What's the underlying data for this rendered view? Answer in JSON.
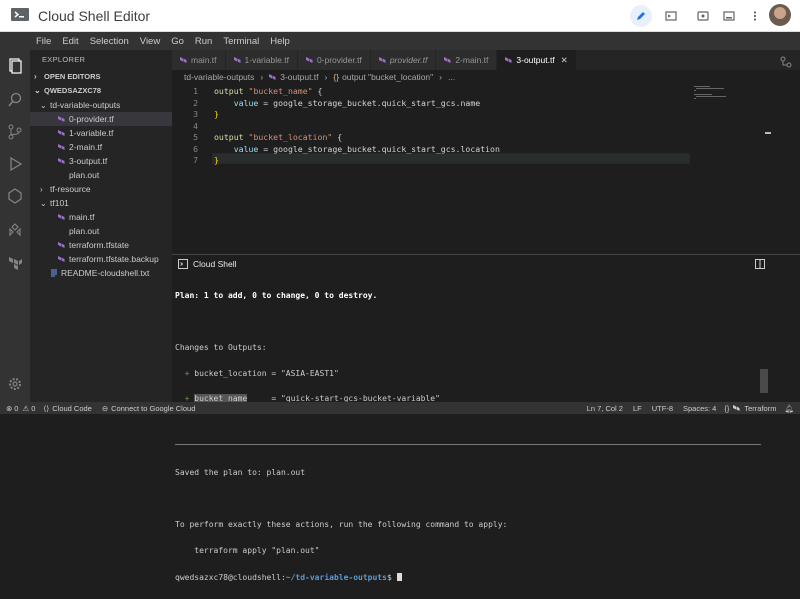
{
  "app": {
    "title": "Cloud Shell Editor"
  },
  "menu": [
    "File",
    "Edit",
    "Selection",
    "View",
    "Go",
    "Run",
    "Terminal",
    "Help"
  ],
  "sidebar": {
    "title": "EXPLORER",
    "open_editors": "OPEN EDITORS",
    "workspace": "QWEDSAZXC78",
    "folder1": "td-variable-outputs",
    "folder1_files": [
      "0-provider.tf",
      "1-variable.tf",
      "2-main.tf",
      "3-output.tf",
      "plan.out"
    ],
    "folder2": "tf-resource",
    "folder3": "tf101",
    "folder3_files": [
      "main.tf",
      "plan.out",
      "terraform.tfstate",
      "terraform.tfstate.backup"
    ],
    "readme": "README-cloudshell.txt"
  },
  "tabs": [
    "main.tf",
    "1-variable.tf",
    "0-provider.tf",
    "provider.tf",
    "2-main.tf",
    "3-output.tf"
  ],
  "breadcrumb": {
    "folder": "td-variable-outputs",
    "file": "3-output.tf",
    "symbol": "output \"bucket_location\"",
    "more": "..."
  },
  "editor": {
    "line_numbers": [
      "1",
      "2",
      "3",
      "4",
      "5",
      "6",
      "7"
    ],
    "l1_kw": "output",
    "l1_str": "\"bucket_name\"",
    "l1_tail": " {",
    "l2_pre": "    ",
    "l2_prop": "value",
    "l2_rest": " = google_storage_bucket.quick_start_gcs.name",
    "l3": "}",
    "l5_kw": "output",
    "l5_str": "\"bucket_location\"",
    "l5_tail": " {",
    "l6_pre": "    ",
    "l6_prop": "value",
    "l6_rest": " = google_storage_bucket.quick_start_gcs.location",
    "l7": "}"
  },
  "panel": {
    "title": "Cloud Shell"
  },
  "terminal": {
    "line1": "Plan: 1 to add, 0 to change, 0 to destroy.",
    "line2": "Changes to Outputs:",
    "line3": "  + bucket_location = \"ASIA-EAST1\"",
    "line4": "  + bucket_name     = \"quick-start-gcs-bucket-variable\"",
    "line5": "Saved the plan to: plan.out",
    "line6": "To perform exactly these actions, run the following command to apply:",
    "line7": "    terraform apply \"plan.out\"",
    "prompt_user": "qwedsazxc78@cloudshell:",
    "prompt_path": "~/td-variable-outputs",
    "prompt_end": "$ "
  },
  "status": {
    "errors": "0",
    "warnings": "0",
    "cloud_code": "Cloud Code",
    "connect": "Connect to Google Cloud",
    "position": "Ln 7, Col 2",
    "eol": "LF",
    "encoding": "UTF-8",
    "spaces": "Spaces: 4",
    "language": "Terraform"
  }
}
